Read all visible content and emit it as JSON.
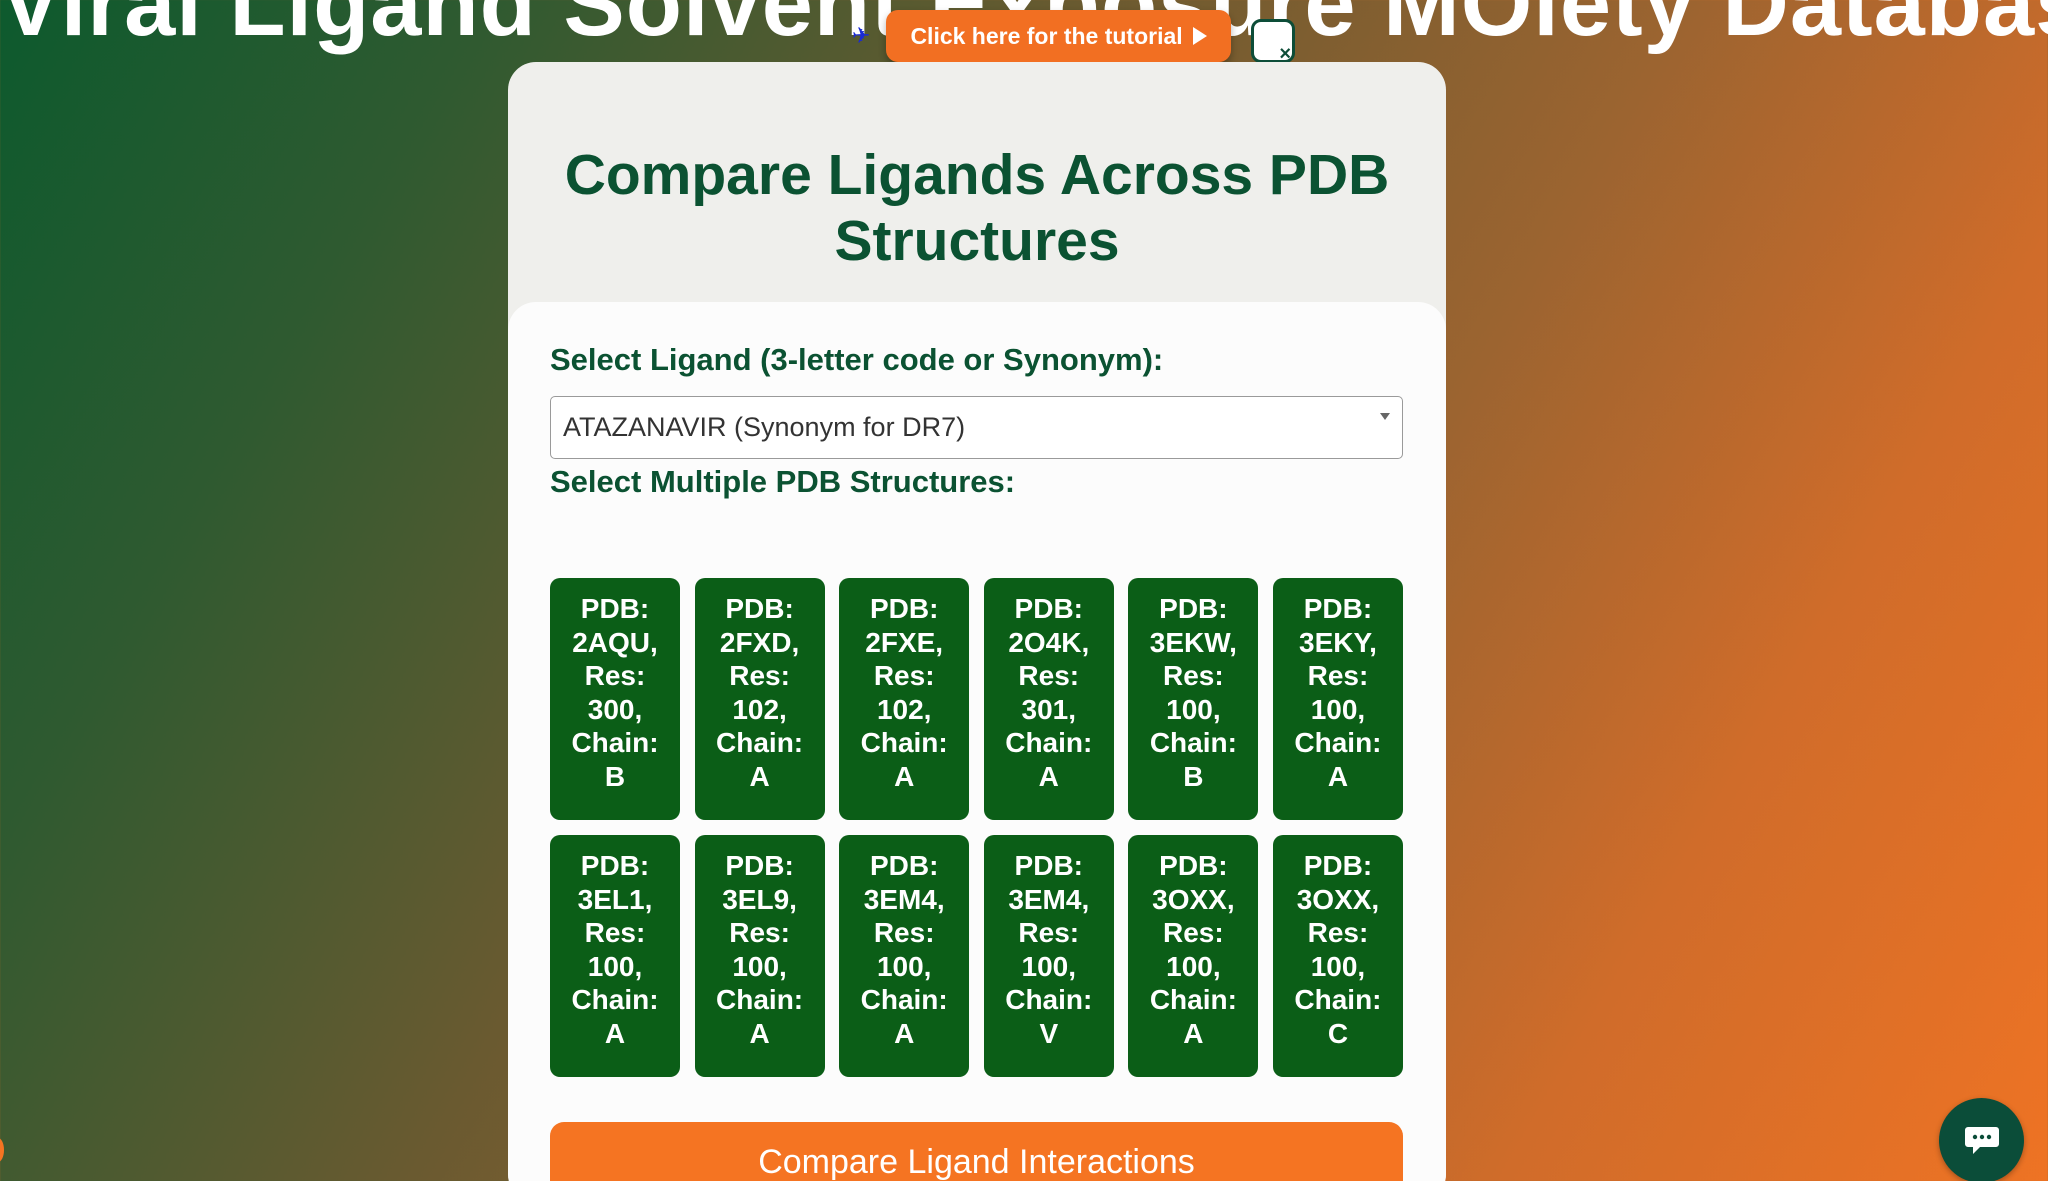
{
  "header": {
    "site_title": "Viral Ligand Solvent Exposure MOiety Database",
    "tutorial_label": "Click here for the tutorial"
  },
  "card": {
    "title": "Compare Ligands Across PDB Structures",
    "ligand_label": "Select Ligand (3-letter code or Synonym):",
    "ligand_selected": "ATAZANAVIR (Synonym for DR7)",
    "structures_label": "Select Multiple PDB Structures:",
    "structures": [
      {
        "pdb": "PDB: 2AQU,",
        "res": "Res: 300,",
        "chain_label": "Chain:",
        "chain": "B"
      },
      {
        "pdb": "PDB: 2FXD,",
        "res": "Res: 102,",
        "chain_label": "Chain:",
        "chain": "A"
      },
      {
        "pdb": "PDB: 2FXE,",
        "res": "Res: 102,",
        "chain_label": "Chain:",
        "chain": "A"
      },
      {
        "pdb": "PDB: 2O4K,",
        "res": "Res: 301,",
        "chain_label": "Chain:",
        "chain": "A"
      },
      {
        "pdb": "PDB: 3EKW,",
        "res": "Res: 100,",
        "chain_label": "Chain:",
        "chain": "B"
      },
      {
        "pdb": "PDB: 3EKY,",
        "res": "Res: 100,",
        "chain_label": "Chain:",
        "chain": "A"
      },
      {
        "pdb": "PDB: 3EL1,",
        "res": "Res: 100,",
        "chain_label": "Chain:",
        "chain": "A"
      },
      {
        "pdb": "PDB: 3EL9,",
        "res": "Res: 100,",
        "chain_label": "Chain:",
        "chain": "A"
      },
      {
        "pdb": "PDB: 3EM4,",
        "res": "Res: 100,",
        "chain_label": "Chain:",
        "chain": "A"
      },
      {
        "pdb": "PDB: 3EM4,",
        "res": "Res: 100,",
        "chain_label": "Chain:",
        "chain": "V"
      },
      {
        "pdb": "PDB: 3OXX,",
        "res": "Res: 100,",
        "chain_label": "Chain:",
        "chain": "A"
      },
      {
        "pdb": "PDB: 3OXX,",
        "res": "Res: 100,",
        "chain_label": "Chain:",
        "chain": "C"
      }
    ],
    "compare_button": "Compare Ligand Interactions"
  },
  "icons": {
    "plane": "airplane-icon",
    "play": "play-icon",
    "close": "close-icon",
    "chevron": "chevron-down-icon",
    "chat": "chat-bubble-icon"
  },
  "colors": {
    "brand_green": "#0b5232",
    "tile_green": "#0b5e17",
    "accent_orange": "#f57422",
    "chat_green": "#0b4d39"
  }
}
